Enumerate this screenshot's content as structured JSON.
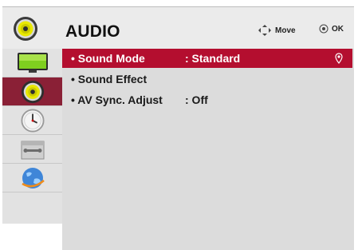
{
  "header": {
    "title": "AUDIO",
    "move_label": "Move",
    "ok_label": "OK"
  },
  "sidebar": {
    "items": [
      {
        "icon": "picture-icon"
      },
      {
        "icon": "speaker-icon",
        "active": true
      },
      {
        "icon": "clock-icon"
      },
      {
        "icon": "toolbox-icon"
      },
      {
        "icon": "globe-icon"
      }
    ]
  },
  "menu": {
    "items": [
      {
        "label": "• Sound Mode",
        "value": ": Standard",
        "selected": true
      },
      {
        "label": "• Sound Effect",
        "value": ""
      },
      {
        "label": "• AV Sync. Adjust",
        "value": ": Off"
      }
    ]
  },
  "colors": {
    "selected_row": "#b40e2f",
    "active_rail": "#8a2036",
    "panel": "#dcdcdc"
  }
}
